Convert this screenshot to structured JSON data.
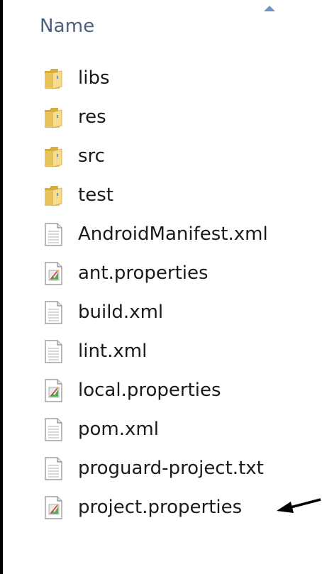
{
  "header": {
    "column_label": "Name",
    "sort_direction": "ascending"
  },
  "items": [
    {
      "label": "libs",
      "type": "folder",
      "icon": "folder-icon"
    },
    {
      "label": "res",
      "type": "folder",
      "icon": "folder-icon"
    },
    {
      "label": "src",
      "type": "folder",
      "icon": "folder-icon"
    },
    {
      "label": "test",
      "type": "folder",
      "icon": "folder-icon"
    },
    {
      "label": "AndroidManifest.xml",
      "type": "file",
      "icon": "document-icon"
    },
    {
      "label": "ant.properties",
      "type": "properties",
      "icon": "properties-file-icon"
    },
    {
      "label": "build.xml",
      "type": "file",
      "icon": "document-icon"
    },
    {
      "label": "lint.xml",
      "type": "file",
      "icon": "document-icon"
    },
    {
      "label": "local.properties",
      "type": "properties",
      "icon": "properties-file-icon"
    },
    {
      "label": "pom.xml",
      "type": "file",
      "icon": "document-icon"
    },
    {
      "label": "proguard-project.txt",
      "type": "file",
      "icon": "document-icon"
    },
    {
      "label": "project.properties",
      "type": "properties",
      "icon": "properties-file-icon"
    }
  ],
  "annotation": {
    "icon": "arrow-pointer-icon",
    "points_to": "project.properties"
  },
  "colors": {
    "header_text": "#4c607a",
    "sort_arrow": "#6f95c1",
    "folder_main": "#e8c25a",
    "folder_light": "#f6dc8e",
    "item_text": "#1a1a1a",
    "background_border": "#000000"
  }
}
